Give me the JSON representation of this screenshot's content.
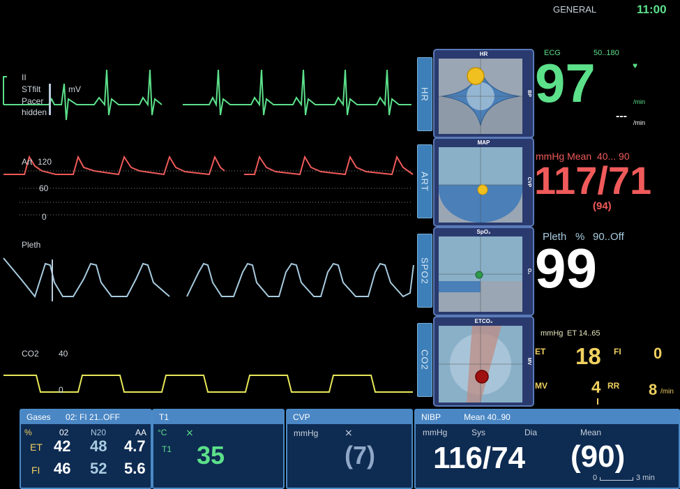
{
  "header": {
    "profile": "GENERAL",
    "time": "11:00"
  },
  "waves": {
    "ecg": {
      "lead": "II",
      "filter": "STfilt",
      "pacer": "Pacer",
      "pacer_state": "hidden",
      "unit": "mV"
    },
    "art": {
      "label": "Art",
      "scale_high": "120",
      "scale_mid": "60",
      "scale_low": "0"
    },
    "pleth": {
      "label": "Pleth"
    },
    "co2": {
      "label": "CO2",
      "scale_high": "40",
      "scale_low": "0"
    }
  },
  "side_tabs": {
    "hr": "HR",
    "art": "ART",
    "spo2": "SPO2",
    "co2": "CO2"
  },
  "gauges": {
    "hr": {
      "top": "HR",
      "right": "BP"
    },
    "map": {
      "top": "MAP",
      "right": "CVP"
    },
    "spo2": {
      "top": "SpO₂",
      "right": "O₂"
    },
    "etco2": {
      "top": "ETCO₂",
      "right": "MV"
    }
  },
  "hr": {
    "label": "ECG",
    "limits": "50..180",
    "value": "97",
    "unit1": "/min",
    "pace_value": "---",
    "unit2": "/min"
  },
  "art": {
    "header": "mmHg Mean  40... 90",
    "value": "117/71",
    "mean": "(94)"
  },
  "spo2": {
    "label": "Pleth",
    "unit": "%",
    "limits": "90..Off",
    "value": "99"
  },
  "co2": {
    "unit": "mmHg",
    "et_limits": "ET 14..65",
    "et_label": "ET",
    "et_value": "18",
    "fi_label": "FI",
    "fi_value": "0",
    "mv_label": "MV",
    "mv_value": "4",
    "rr_label": "RR",
    "rr_value": "8",
    "rr_unit": "/min"
  },
  "gases": {
    "title": "Gases",
    "o2_alarm": "02: FI  21..OFF",
    "col_pct": "%",
    "col_o2": "02",
    "col_n2o": "N20",
    "col_aa": "AA",
    "et_label": "ET",
    "fi_label": "FI",
    "et_o2": "42",
    "et_n2o": "48",
    "et_aa": "4.7",
    "fi_o2": "46",
    "fi_n2o": "52",
    "fi_aa": "5.6"
  },
  "temp": {
    "title": "T1",
    "unit": "°C",
    "label": "T1",
    "value": "35"
  },
  "cvp": {
    "title": "CVP",
    "unit": "mmHg",
    "value": "(7)"
  },
  "nibp": {
    "title": "NIBP",
    "limits": "Mean 40..90",
    "unit": "mmHg",
    "sys_label": "Sys",
    "dia_label": "Dia",
    "mean_label": "Mean",
    "value": "116/74",
    "mean": "(90)",
    "scale_start": "0",
    "scale_end": "3 min"
  },
  "colors": {
    "ecg": "#5ce08a",
    "art": "#f05a5a",
    "pleth": "#a8cce0",
    "co2": "#e8e85a",
    "panel": "#0e2b52",
    "panel_title": "#4a87c4"
  }
}
